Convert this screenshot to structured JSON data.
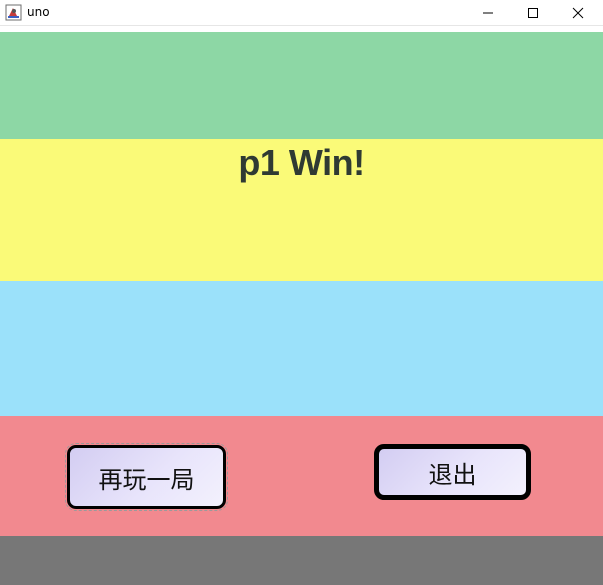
{
  "window": {
    "title": "uno",
    "controls": {
      "minimize_icon": "minimize-icon",
      "maximize_icon": "maximize-icon",
      "close_icon": "close-icon"
    }
  },
  "colors": {
    "green": "#8dd7a5",
    "yellow": "#fafa78",
    "blue": "#9be1fa",
    "red": "#f2898f",
    "gray": "#777777",
    "button_fill": "#e8e4fb",
    "text": "#2f3a33"
  },
  "result": {
    "message": "p1 Win!"
  },
  "buttons": {
    "replay_label": "再玩一局",
    "quit_label": "退出"
  }
}
